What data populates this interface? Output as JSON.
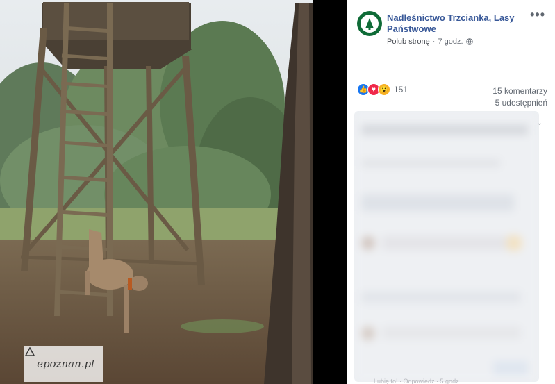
{
  "post": {
    "page_name": "Nadleśnictwo Trzcianka, Lasy Państwowe",
    "like_page": "Polub stronę",
    "separator": "·",
    "time": "7 godz.",
    "more_label": "•••"
  },
  "reactions": {
    "count": "151",
    "comments": "15 komentarzy",
    "shares": "5 udostępnień"
  },
  "watermark": {
    "text": "epoznan.pl"
  },
  "faint_footer": "Lubię to! · Odpowiedz · 5 godz.",
  "icons": {
    "logo": "lasy-panstwowe-logo",
    "globe": "globe-icon",
    "like": "like-reaction-icon",
    "love": "love-reaction-icon",
    "wow": "wow-reaction-icon"
  },
  "colors": {
    "page_name": "#385898",
    "like": "#1877f2",
    "love": "#f0284a",
    "wow": "#f7b125",
    "logo_green": "#0f6b37"
  }
}
